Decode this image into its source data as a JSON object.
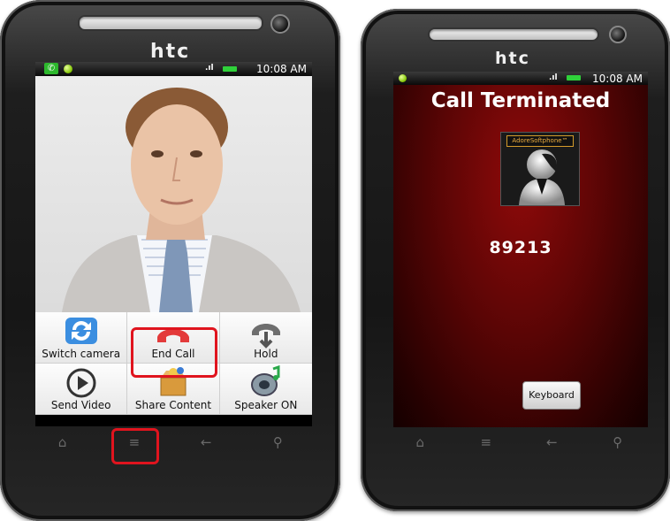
{
  "left_phone": {
    "brand": "htc",
    "status_time": "10:08 AM",
    "menu": [
      {
        "label": "Switch camera",
        "icon": "switch-camera-icon"
      },
      {
        "label": "End Call",
        "icon": "end-call-icon"
      },
      {
        "label": "Hold",
        "icon": "hold-icon"
      },
      {
        "label": "Send Video",
        "icon": "play-icon"
      },
      {
        "label": "Share Content",
        "icon": "share-content-icon"
      },
      {
        "label": "Speaker ON",
        "icon": "speaker-icon"
      }
    ],
    "nav": {
      "home": "⌂",
      "menu": "≡",
      "back": "←",
      "search": "⚲"
    }
  },
  "right_phone": {
    "brand": "htc",
    "status_time": "10:08 AM",
    "title": "Call Terminated",
    "avatar_brand": "AdoreSoftphone™",
    "number": "89213",
    "keyboard_label": "Keyboard",
    "nav": {
      "home": "⌂",
      "menu": "≡",
      "back": "←",
      "search": "⚲"
    }
  },
  "colors": {
    "highlight": "#e0141e",
    "call_bg": "#6a0606",
    "status_green": "#2fd13a"
  }
}
